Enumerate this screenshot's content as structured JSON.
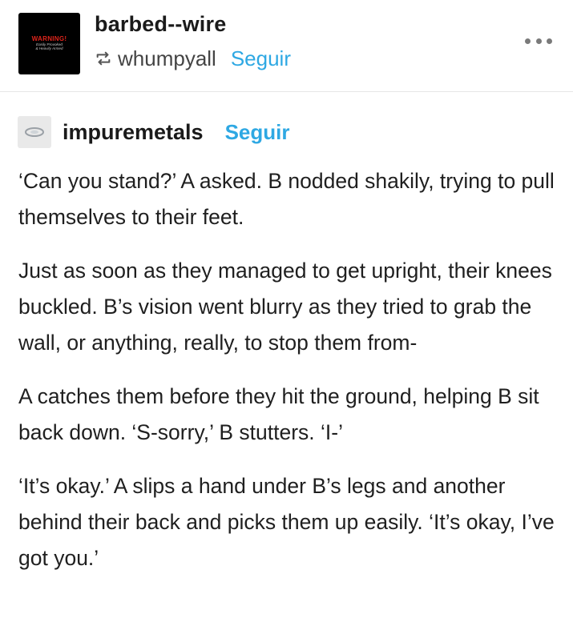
{
  "header": {
    "avatar": {
      "warning_text": "WARNING!",
      "line1": "Easily Provoked",
      "line2": "& Heavily Armed"
    },
    "blog_name": "barbed--wire",
    "reblog_icon": "reblog-icon",
    "reblogged_from": "whumpyall",
    "follow_label": "Seguir",
    "more_icon": "more-options-icon"
  },
  "trail": {
    "name": "impuremetals",
    "follow_label": "Seguir",
    "paragraphs": [
      "‘Can you stand?’ A asked. B nodded shakily, trying to pull themselves to their feet.",
      "Just as soon as they managed to get upright, their knees buckled. B’s vision went blurry as they tried to grab the wall, or anything, really, to stop them from-",
      "A catches them before they hit the ground, helping B sit back down. ‘S-sorry,’ B stutters. ‘I-’",
      "‘It’s okay.’ A slips a hand under B’s legs and another behind their back and picks them up easily. ‘It’s okay, I’ve got you.’"
    ]
  },
  "colors": {
    "follow_blue": "#2ea8e3",
    "warning_red": "#e0241b",
    "text": "#1f1f1f"
  }
}
